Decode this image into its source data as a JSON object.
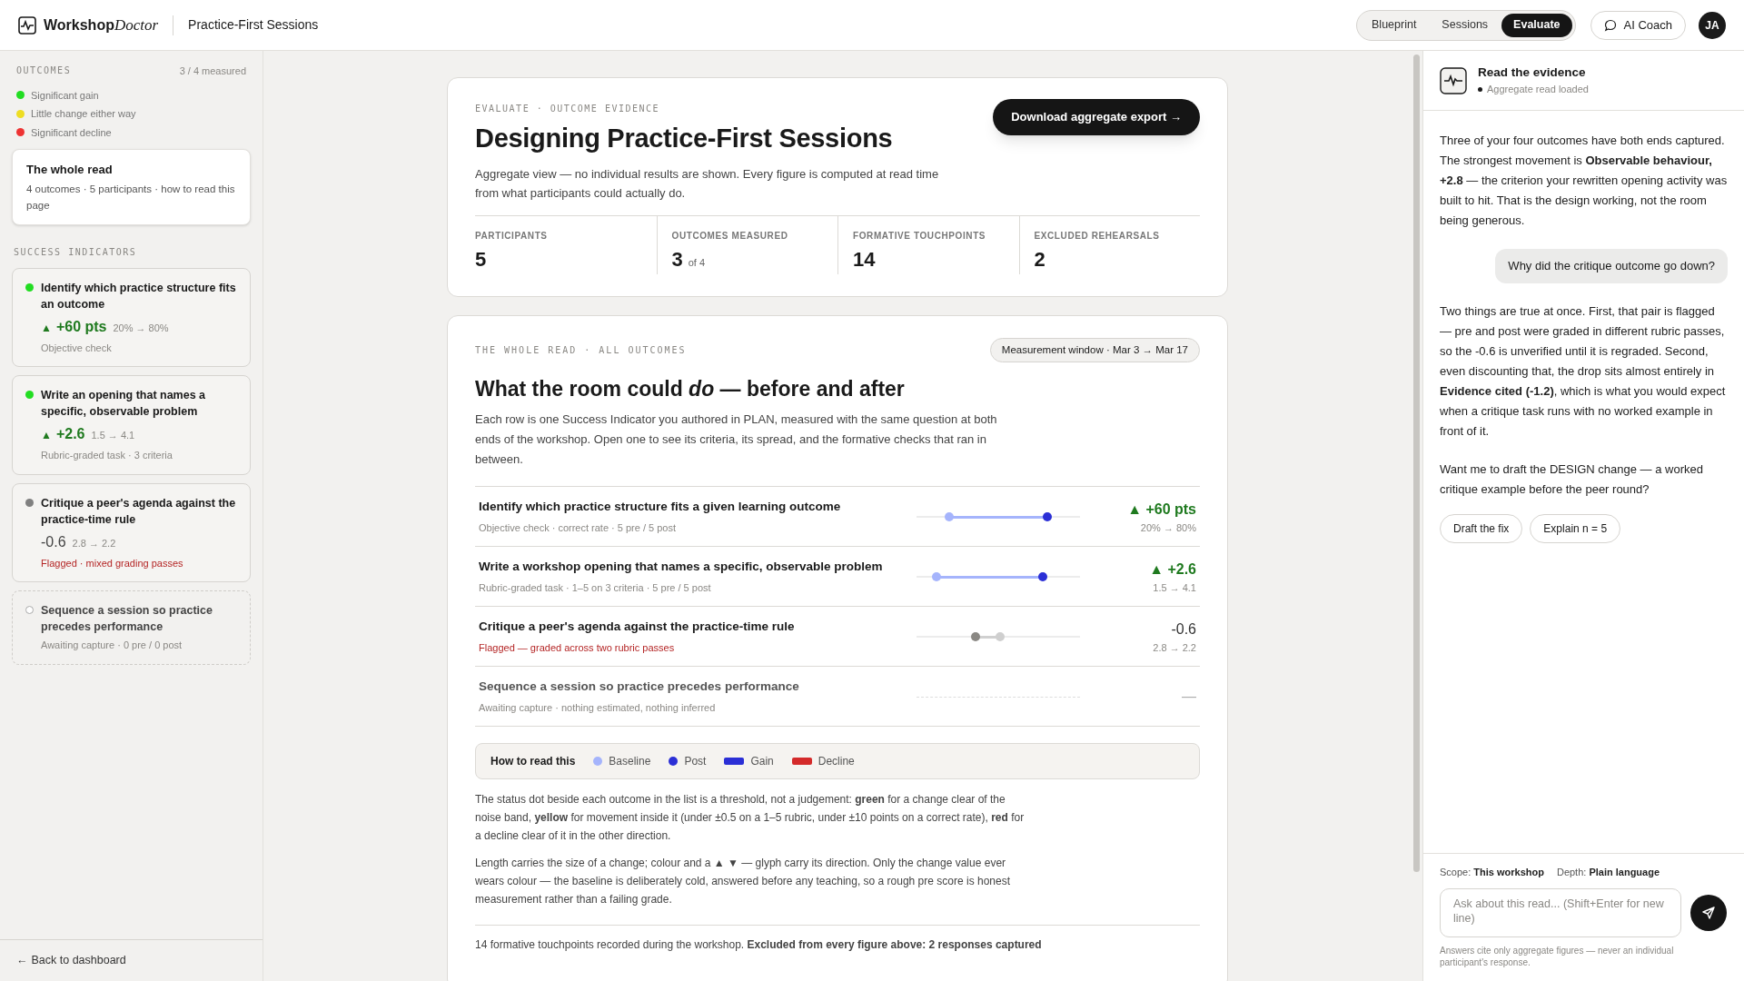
{
  "header": {
    "brand": "Workshop",
    "brand_accent": "Doctor",
    "page_title": "Practice-First Sessions",
    "tabs": [
      {
        "label": "Blueprint",
        "selected": false
      },
      {
        "label": "Sessions",
        "selected": false
      },
      {
        "label": "Evaluate",
        "selected": true
      }
    ],
    "coach_button": "AI Coach",
    "avatar": "JA"
  },
  "sidebar": {
    "outcomes_heading": "OUTCOMES",
    "measured": "3 / 4 measured",
    "legend": [
      {
        "label": "Significant gain",
        "color": "#22dd22"
      },
      {
        "label": "Little change either way",
        "color": "#eedd22"
      },
      {
        "label": "Significant decline",
        "color": "#ee3333"
      }
    ],
    "whole_read": {
      "title": "The whole read",
      "subtitle": "4 outcomes · 5 participants · how to read this page"
    },
    "indicators_heading": "SUCCESS INDICATORS",
    "indicators": [
      {
        "kind": "gain",
        "color": "#22dd22",
        "title": "Identify which practice structure fits an outcome",
        "arrow": "▲",
        "delta": "+60 pts",
        "range": "20% → 80%",
        "note": "Objective check",
        "flagged": false
      },
      {
        "kind": "gain",
        "color": "#22dd22",
        "title": "Write an opening that names a specific, observable problem",
        "arrow": "▲",
        "delta": "+2.6",
        "range": "1.5 → 4.1",
        "note": "Rubric-graded task · 3 criteria",
        "flagged": false
      },
      {
        "kind": "flat",
        "color": "#808080",
        "title": "Critique a peer's agenda against the practice-time rule",
        "delta": "-0.6",
        "range": "2.8 → 2.2",
        "note": "Flagged · mixed grading passes",
        "flagged": true
      },
      {
        "kind": "pending",
        "title": "Sequence a session so practice precedes performance",
        "note": "Awaiting capture · 0 pre / 0 post",
        "flagged": false
      }
    ],
    "back_icon": "←",
    "back_link": "Back to dashboard"
  },
  "summary": {
    "eyebrow": "EVALUATE · OUTCOME EVIDENCE",
    "title": "Designing Practice-First Sessions",
    "description": "Aggregate view — no individual results are shown. Every figure is computed at read time from what participants could actually do.",
    "export_button": "Download aggregate export →",
    "stats": [
      {
        "label": "PARTICIPANTS",
        "value": "5"
      },
      {
        "label": "OUTCOMES MEASURED",
        "value": "3",
        "suffix": "of 4"
      },
      {
        "label": "FORMATIVE TOUCHPOINTS",
        "value": "14"
      },
      {
        "label": "EXCLUDED REHEARSALS",
        "value": "2"
      }
    ]
  },
  "whole_read": {
    "eyebrow": "THE WHOLE READ · ALL OUTCOMES",
    "window_chip": "Measurement window · Mar 3 → Mar 17",
    "title": "What the room could *do* — before and after",
    "description": "Each row is one Success Indicator you authored in PLAN, measured with the same question at both ends of the workshop. Open one to see its criteria, its spread, and the formative checks that ran in between.",
    "rows": [
      {
        "kind": "gain",
        "title": "Identify which practice structure fits a given learning outcome",
        "subtitle": "Objective check · correct rate · 5 pre / 5 post",
        "flagged": false,
        "baseline": {
          "level": 0.2
        },
        "post": {
          "level": 0.8
        },
        "delta": "▲ +60 pts",
        "range": "20% → 80%"
      },
      {
        "kind": "gain",
        "title": "Write a workshop opening that names a specific, observable problem",
        "subtitle": "Rubric-graded task · 1–5 on 3 criteria · 5 pre / 5 post",
        "flagged": false,
        "baseline": {
          "level": 0.12
        },
        "post": {
          "level": 0.77
        },
        "delta": "▲ +2.6",
        "range": "1.5 → 4.1"
      },
      {
        "kind": "flat",
        "title": "Critique a peer's agenda against the practice-time rule",
        "subtitle": "Flagged — graded across two rubric passes",
        "flagged": true,
        "baseline": {
          "level": 0.51
        },
        "post": {
          "level": 0.36
        },
        "delta": "-0.6",
        "range": "2.8 → 2.2"
      },
      {
        "kind": "pending",
        "title": "Sequence a session so practice precedes performance",
        "subtitle": "Awaiting capture · nothing estimated, nothing inferred",
        "flagged": false,
        "delta": "—"
      }
    ],
    "legend_title": "How to read this",
    "legend": [
      {
        "kind": "dot",
        "label": "Baseline",
        "color": "#a5b4fc"
      },
      {
        "kind": "dot",
        "label": "Post",
        "color": "#2b2fd6"
      },
      {
        "kind": "bar",
        "label": "Gain",
        "color": "#2b2fd6"
      },
      {
        "kind": "bar",
        "label": "Decline",
        "color": "#d42a2a"
      }
    ],
    "paragraphs": [
      "The status dot beside each outcome in the list is a threshold, not a judgement: **green** for a change clear of the noise band, **yellow** for movement inside it (under ±0.5 on a 1–5 rubric, under ±10 points on a correct rate), **red** for a decline clear of it in the other direction.",
      "Length carries the size of a change; colour and a ▲ ▼ — glyph carry its direction. Only the change value ever wears colour — the baseline is deliberately cold, answered before any teaching, so a rough pre score is honest measurement rather than a failing grade."
    ],
    "footnote": "14 formative touchpoints recorded during the workshop. **Excluded from every figure above: 2 responses captured**"
  },
  "coach": {
    "title": "Read the evidence",
    "status": "Aggregate read loaded",
    "messages": [
      {
        "kind": "assistant",
        "text": "Three of your four outcomes have both ends captured. The strongest movement is **Observable behaviour, +2.8** — the criterion your rewritten opening activity was built to hit. That is the design working, not the room being generous."
      },
      {
        "kind": "user",
        "text": "Why did the critique outcome go down?"
      },
      {
        "kind": "assistant",
        "text": "Two things are true at once. First, that pair is flagged — pre and post were graded in different rubric passes, so the -0.6 is unverified until it is regraded. Second, even discounting that, the drop sits almost entirely in **Evidence cited (-1.2)**, which is what you would expect when a critique task runs with no worked example in front of it."
      },
      {
        "kind": "assistant",
        "text": "Want me to draft the DESIGN change — a worked critique example before the peer round?"
      }
    ],
    "suggestions": [
      "Draft the fix",
      "Explain n = 5"
    ],
    "scope_label": "Scope:",
    "scope": "This workshop",
    "depth_label": "Depth:",
    "depth": "Plain language",
    "placeholder": "Ask about this read... (Shift+Enter for new line)",
    "disclaimer": "Answers cite only aggregate figures — never an individual participant's response."
  }
}
